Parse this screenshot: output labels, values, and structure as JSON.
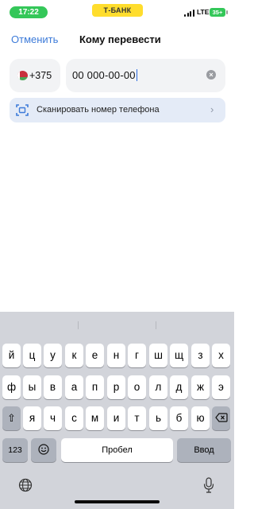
{
  "status_bar": {
    "time": "17:22",
    "carrier_label": "Т-БАНК",
    "network": "LTE",
    "battery": "35+",
    "time_color": "#34c759",
    "brand_color": "#ffdd2d"
  },
  "nav": {
    "cancel_label": "Отменить",
    "title": "Кому перевести"
  },
  "phone_form": {
    "country_code": "+375",
    "country_flag_icon": "belarus-flag-icon",
    "phone_value": "00 000-00-00",
    "clear_icon": "clear-icon"
  },
  "scan": {
    "label": "Сканировать номер телефона",
    "icon": "scan-icon",
    "chevron_icon": "chevron-right-icon",
    "background": "#e4ebf7"
  },
  "keyboard": {
    "row1": [
      "й",
      "ц",
      "у",
      "к",
      "е",
      "н",
      "г",
      "ш",
      "щ",
      "з",
      "х"
    ],
    "row2": [
      "ф",
      "ы",
      "в",
      "а",
      "п",
      "р",
      "о",
      "л",
      "д",
      "ж",
      "э"
    ],
    "row3": [
      "я",
      "ч",
      "с",
      "м",
      "и",
      "т",
      "ь",
      "б",
      "ю"
    ],
    "numbers_label": "123",
    "space_label": "Пробел",
    "return_label": "Ввод",
    "shift_icon": "shift-icon",
    "backspace_icon": "backspace-icon",
    "emoji_icon": "emoji-icon",
    "globe_icon": "globe-icon",
    "mic_icon": "microphone-icon"
  }
}
